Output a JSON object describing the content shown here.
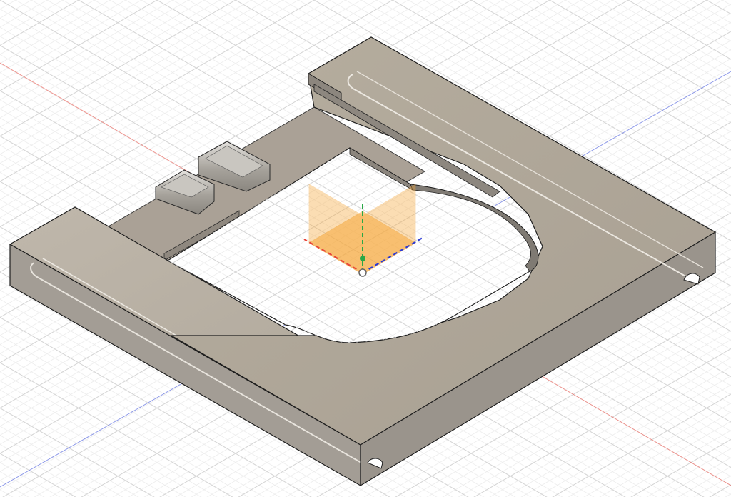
{
  "viewport": {
    "view": "isometric",
    "background_color": "#ffffff",
    "grid": {
      "visible": true,
      "minor_color": "#ececec",
      "major_color": "#d4d4d4"
    },
    "axes": {
      "x_axis_color": "#e8443a",
      "y_axis_color": "#2aa846",
      "z_axis_color": "#3348d8"
    },
    "model": {
      "body_color": "#b4ac9f",
      "body_top_color": "#b8b0a3",
      "body_side_color": "#9e9890",
      "body_front_color": "#a59f97",
      "edge_color": "#1f1f1f",
      "floor_color": "#aaa196"
    },
    "origin_planes_color": "#f7a83a"
  }
}
